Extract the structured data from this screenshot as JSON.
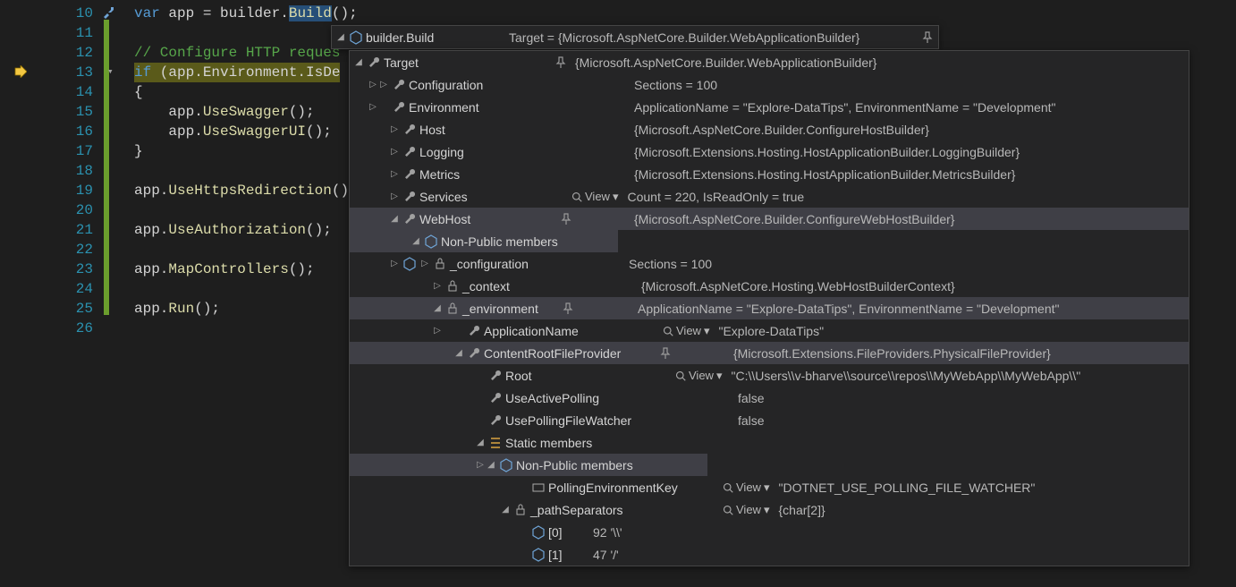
{
  "code": {
    "line10_num": "10",
    "line10_a": "var",
    "line10_b": " app = builder.",
    "line10_c": "Build",
    "line10_d": "();",
    "line11_num": "11",
    "line12_num": "12",
    "line12_cmt": "// Configure HTTP reques",
    "line13_num": "13",
    "line13_a": "if",
    "line13_b": " (app.Environment.IsDe",
    "line14_num": "14",
    "line14_a": "{",
    "line15_num": "15",
    "line15_a": "    app.",
    "line15_b": "UseSwagger",
    "line15_c": "();",
    "line16_num": "16",
    "line16_a": "    app.",
    "line16_b": "UseSwaggerUI",
    "line16_c": "();",
    "line17_num": "17",
    "line17_a": "}",
    "line18_num": "18",
    "line19_num": "19",
    "line19_a": "app.",
    "line19_b": "UseHttpsRedirection",
    "line19_c": "();",
    "line20_num": "20",
    "line21_num": "21",
    "line21_a": "app.",
    "line21_b": "UseAuthorization",
    "line21_c": "();",
    "line22_num": "22",
    "line23_num": "23",
    "line23_a": "app.",
    "line23_b": "MapControllers",
    "line23_c": "();",
    "line24_num": "24",
    "line25_num": "25",
    "line25_a": "app.",
    "line25_b": "Run",
    "line25_c": "();",
    "line26_num": "26"
  },
  "tip": {
    "root_name": "builder.Build",
    "root_value": "Target = {Microsoft.AspNetCore.Builder.WebApplicationBuilder}",
    "target_name": "Target",
    "target_value": "{Microsoft.AspNetCore.Builder.WebApplicationBuilder}",
    "config_name": "Configuration",
    "config_value": "Sections = 100",
    "env_name": "Environment",
    "env_value": "ApplicationName = \"Explore-DataTips\", EnvironmentName = \"Development\"",
    "host_name": "Host",
    "host_value": "{Microsoft.AspNetCore.Builder.ConfigureHostBuilder}",
    "logging_name": "Logging",
    "logging_value": "{Microsoft.Extensions.Hosting.HostApplicationBuilder.LoggingBuilder}",
    "metrics_name": "Metrics",
    "metrics_value": "{Microsoft.Extensions.Hosting.HostApplicationBuilder.MetricsBuilder}",
    "services_name": "Services",
    "services_value": "Count = 220, IsReadOnly = true",
    "webhost_name": "WebHost",
    "webhost_value": "{Microsoft.AspNetCore.Builder.ConfigureWebHostBuilder}",
    "nonpublic_name": "Non-Public members",
    "cfg_name": "_configuration",
    "cfg_value": "Sections = 100",
    "ctx_name": "_context",
    "ctx_value": "{Microsoft.AspNetCore.Hosting.WebHostBuilderContext}",
    "envp_name": "_environment",
    "envp_value": "ApplicationName = \"Explore-DataTips\", EnvironmentName = \"Development\"",
    "appname_name": "ApplicationName",
    "appname_value": "\"Explore-DataTips\"",
    "crfp_name": "ContentRootFileProvider",
    "crfp_value": "{Microsoft.Extensions.FileProviders.PhysicalFileProvider}",
    "root_p_name": "Root",
    "root_p_value": "\"C:\\\\Users\\\\v-bharve\\\\source\\\\repos\\\\MyWebApp\\\\MyWebApp\\\\\"",
    "uap_name": "UseActivePolling",
    "uap_value": "false",
    "upfw_name": "UsePollingFileWatcher",
    "upfw_value": "false",
    "static_name": "Static members",
    "nonpublic2_name": "Non-Public members",
    "pek_name": "PollingEnvironmentKey",
    "pek_value": "\"DOTNET_USE_POLLING_FILE_WATCHER\"",
    "ps_name": "_pathSeparators",
    "ps_value": "{char[2]}",
    "ps0_name": "[0]",
    "ps0_value": "92 '\\\\'",
    "ps1_name": "[1]",
    "ps1_value": "47 '/'",
    "view_label": "View"
  }
}
